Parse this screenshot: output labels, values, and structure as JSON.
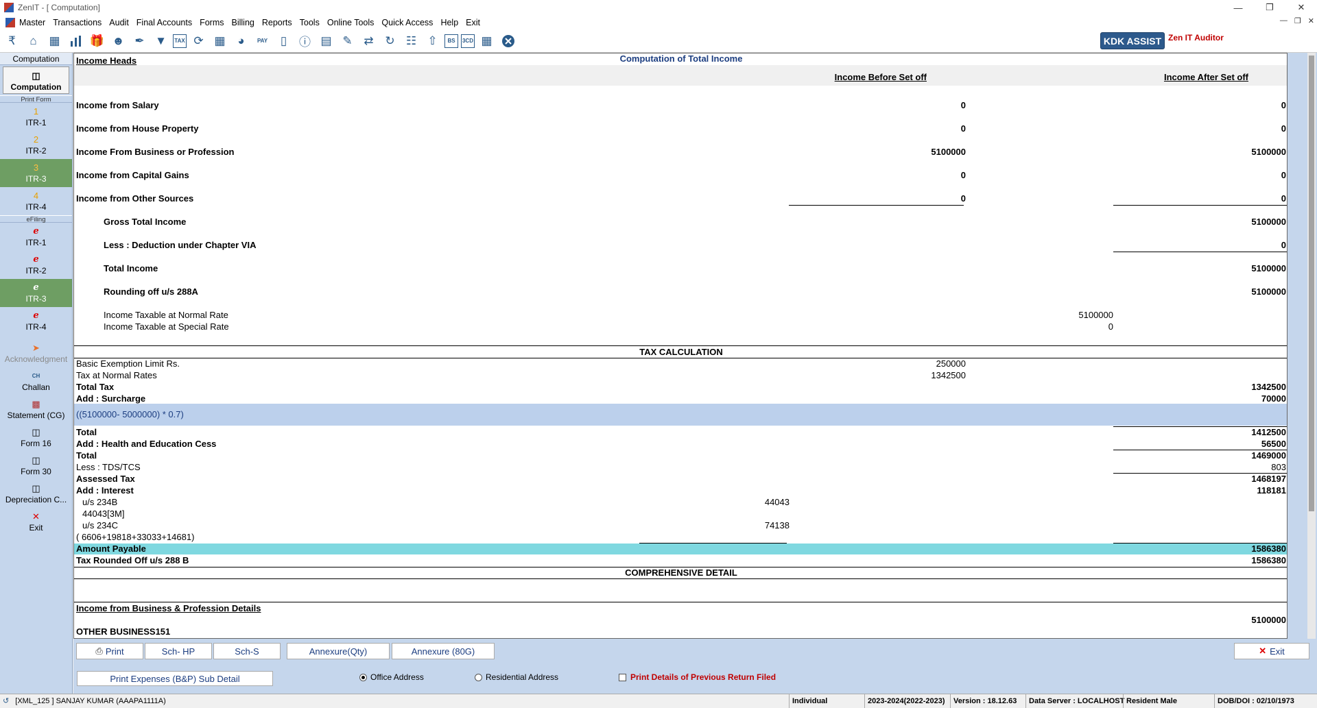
{
  "window": {
    "title": "ZenIT - [ Computation]"
  },
  "menu": [
    "Master",
    "Transactions",
    "Audit",
    "Final Accounts",
    "Forms",
    "Billing",
    "Reports",
    "Tools",
    "Online Tools",
    "Quick Access",
    "Help",
    "Exit"
  ],
  "toolbar": {
    "icons": [
      "rupee-icon",
      "home-icon",
      "building-icon",
      "bar-chart-icon",
      "gift-icon",
      "users-icon",
      "pin-icon",
      "filter-icon",
      "tax-icon",
      "refresh-icon",
      "calculator-icon",
      "pie-chart-icon",
      "pay-icon",
      "book-icon",
      "info-icon",
      "report-icon",
      "edit-icon",
      "transfer-icon",
      "sync-icon",
      "calendar-icon",
      "upload-icon",
      "bs-icon",
      "3cd-icon",
      "grid-icon",
      "close-icon"
    ],
    "tax_label": "TAX",
    "pay_label": "PAY",
    "bs_label": "BS",
    "cd_label": "3CD",
    "kdk_assist": "KDK ASSIST",
    "zen_auditor": "Zen IT Auditor"
  },
  "sidebar": {
    "header": "Computation",
    "computation_btn": "Computation",
    "print_form": "Print Form",
    "itr_print": [
      {
        "num": "1",
        "label": "ITR-1"
      },
      {
        "num": "2",
        "label": "ITR-2"
      },
      {
        "num": "3",
        "label": "ITR-3"
      },
      {
        "num": "4",
        "label": "ITR-4"
      }
    ],
    "efiling": "eFiling",
    "itr_efile": [
      {
        "label": "ITR-1"
      },
      {
        "label": "ITR-2"
      },
      {
        "label": "ITR-3"
      },
      {
        "label": "ITR-4"
      }
    ],
    "acknowledgment": "Acknowledgment",
    "challan": "Challan",
    "statement_cg": "Statement (CG)",
    "form16": "Form 16",
    "form30": "Form 30",
    "depreciation": "Depreciation C...",
    "exit": "Exit",
    "challan_icon_text": "CH"
  },
  "report": {
    "title": "Computation of Total Income",
    "income_heads": "Income Heads",
    "col_before": "Income Before Set off",
    "col_after": "Income After Set off",
    "rows": [
      {
        "label": "Income from Salary",
        "before": "0",
        "after": "0"
      },
      {
        "label": "Income from House Property",
        "before": "0",
        "after": "0"
      },
      {
        "label": "Income From Business or Profession",
        "before": "5100000",
        "after": "5100000"
      },
      {
        "label": "Income from Capital Gains",
        "before": "0",
        "after": "0"
      },
      {
        "label": "Income from Other Sources",
        "before": "0",
        "after": "0"
      }
    ],
    "gross_total": {
      "label": "Gross Total Income",
      "value": "5100000"
    },
    "deduction": {
      "label": "Less : Deduction under Chapter VIA",
      "value": "0"
    },
    "total_income": {
      "label": "Total Income",
      "value": "5100000"
    },
    "rounding": {
      "label": "Rounding off u/s 288A",
      "value": "5100000"
    },
    "normal_rate": {
      "label": "Income Taxable at Normal Rate",
      "value": "5100000"
    },
    "special_rate": {
      "label": "Income Taxable at Special Rate",
      "value": "0"
    },
    "tax_calc_title": "TAX CALCULATION",
    "basic_exemption": {
      "label": "Basic Exemption Limit Rs.",
      "value": "250000"
    },
    "tax_normal": {
      "label": "Tax at Normal Rates",
      "value": "1342500"
    },
    "total_tax": {
      "label": "Total Tax",
      "value": "1342500"
    },
    "surcharge": {
      "label": "Add : Surcharge",
      "value": "70000"
    },
    "surcharge_formula": "((5100000- 5000000) * 0.7)",
    "total1": {
      "label": "Total",
      "value": "1412500"
    },
    "cess": {
      "label": "Add : Health and Education Cess",
      "value": "56500"
    },
    "total2": {
      "label": "Total",
      "value": "1469000"
    },
    "tds": {
      "label": "Less : TDS/TCS",
      "value": "803"
    },
    "assessed": {
      "label": "Assessed Tax",
      "value": "1468197"
    },
    "interest": {
      "label": "Add : Interest",
      "value": "118181"
    },
    "u234b": {
      "label": "u/s 234B",
      "value": "44043"
    },
    "u234b_detail": "44043[3M]",
    "u234c": {
      "label": "u/s 234C",
      "value": "74138"
    },
    "u234c_detail": "(  6606+19818+33033+14681)",
    "amount_payable": {
      "label": "Amount Payable",
      "value": "1586380"
    },
    "tax_rounded": {
      "label": "Tax Rounded Off u/s 288 B",
      "value": "1586380"
    },
    "comprehensive_title": "COMPREHENSIVE DETAIL",
    "business_details": "Income from Business & Profession Details",
    "other_business": {
      "label": "OTHER BUSINESS151",
      "value": "5100000"
    }
  },
  "bottom": {
    "print": "Print",
    "sch_hp": "Sch- HP",
    "sch_s": "Sch-S",
    "annexure_qty": "Annexure(Qty)",
    "annexure_80g": "Annexure (80G)",
    "exit": "Exit",
    "print_expenses": "Print Expenses (B&P) Sub Detail",
    "office_address": "Office Address",
    "residential_address": "Residential Address",
    "print_prev": "Print Details of Previous Return Filed"
  },
  "status": {
    "client": "[XML_125 ] SANJAY KUMAR (AAAPA1111A)",
    "type": "Individual",
    "year": "2023-2024(2022-2023)",
    "version": "Version : 18.12.63",
    "server": "Data Server : LOCALHOST",
    "resident": "Resident Male",
    "dob": "DOB/DOI : 02/10/1973"
  },
  "colors": {
    "accent_blue": "#1b3d80",
    "highlight_row": "#7fd8e0",
    "formula_row": "#bcd0ec",
    "active_green": "#6e9e63",
    "kdk_blue": "#2d5a8c"
  }
}
